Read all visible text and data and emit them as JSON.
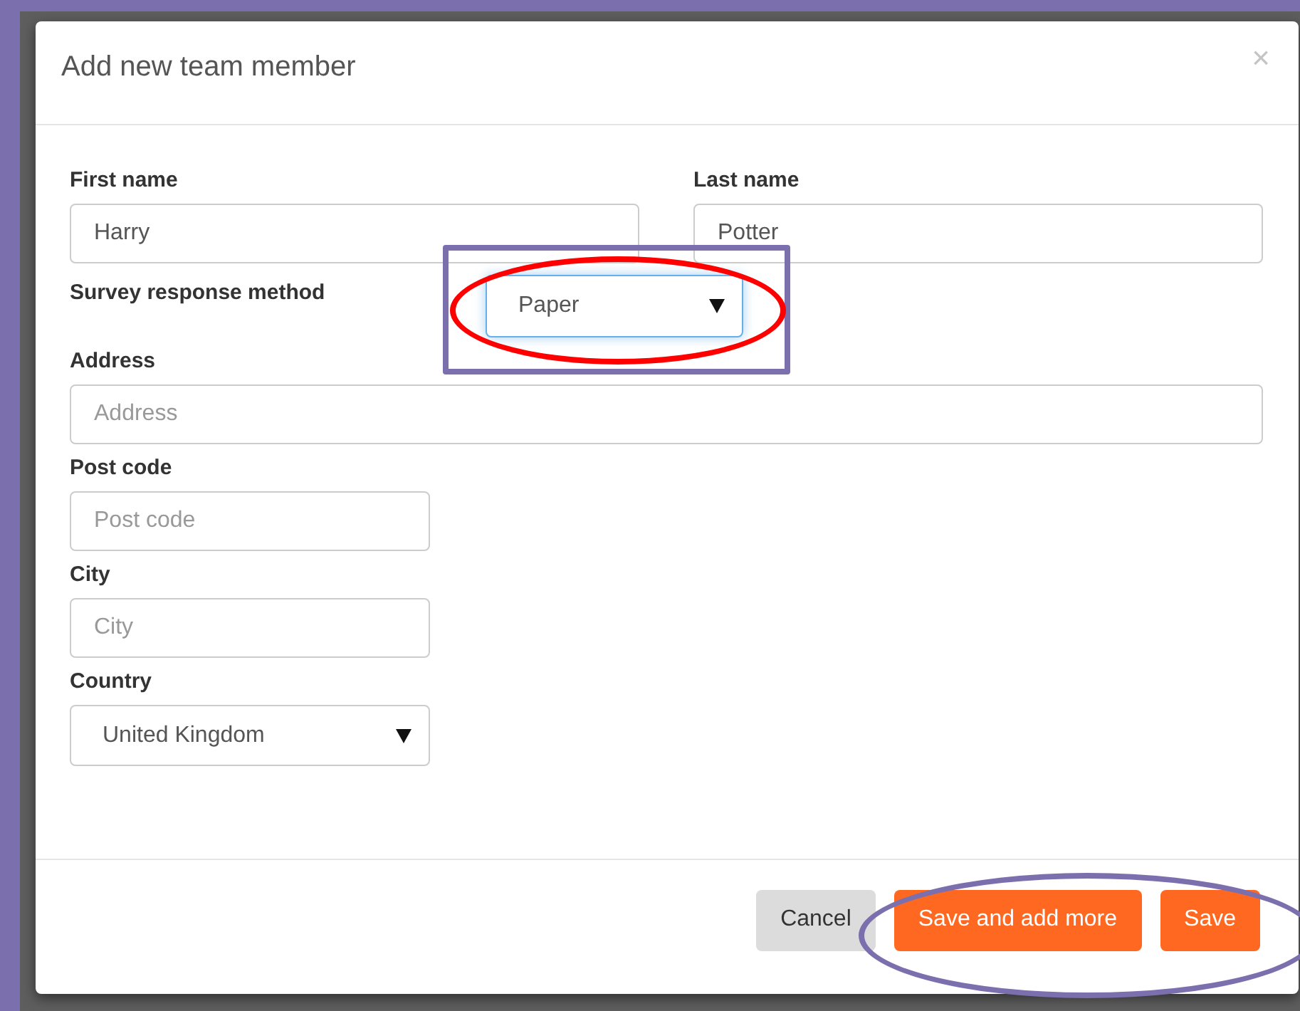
{
  "dialog": {
    "title": "Add new team member",
    "close": "×"
  },
  "rows": [
    [
      {
        "label": "First name",
        "kind": "text",
        "value": "Harry",
        "focused": false
      },
      {
        "label": "Last name",
        "kind": "text",
        "value": "Potter",
        "focused": false
      }
    ],
    [
      {
        "label": "Survey response method",
        "kind": "inline_select",
        "value": "Paper",
        "focused": true
      }
    ],
    [
      {
        "label": "Address",
        "kind": "text",
        "placeholder": "Address",
        "focused": false
      }
    ],
    [
      {
        "label": "Post code",
        "kind": "short_text",
        "placeholder": "Post code",
        "focused": false
      }
    ],
    [
      {
        "label": "City",
        "kind": "short_text",
        "placeholder": "City",
        "focused": false
      }
    ],
    [
      {
        "label": "Country",
        "kind": "select",
        "value": "United Kingdom",
        "focused": false
      }
    ]
  ],
  "buttons": [
    {
      "label": "Cancel",
      "kind": "secondary"
    },
    {
      "label": "Save and add more",
      "kind": "primary"
    },
    {
      "label": "Save",
      "kind": "primary"
    }
  ],
  "annotations": [
    {
      "kind": "rectangle",
      "color": "#7b6fae"
    },
    {
      "kind": "ellipse",
      "color": "#ff0000"
    },
    {
      "kind": "ellipse",
      "color": "#7b6fae"
    }
  ]
}
